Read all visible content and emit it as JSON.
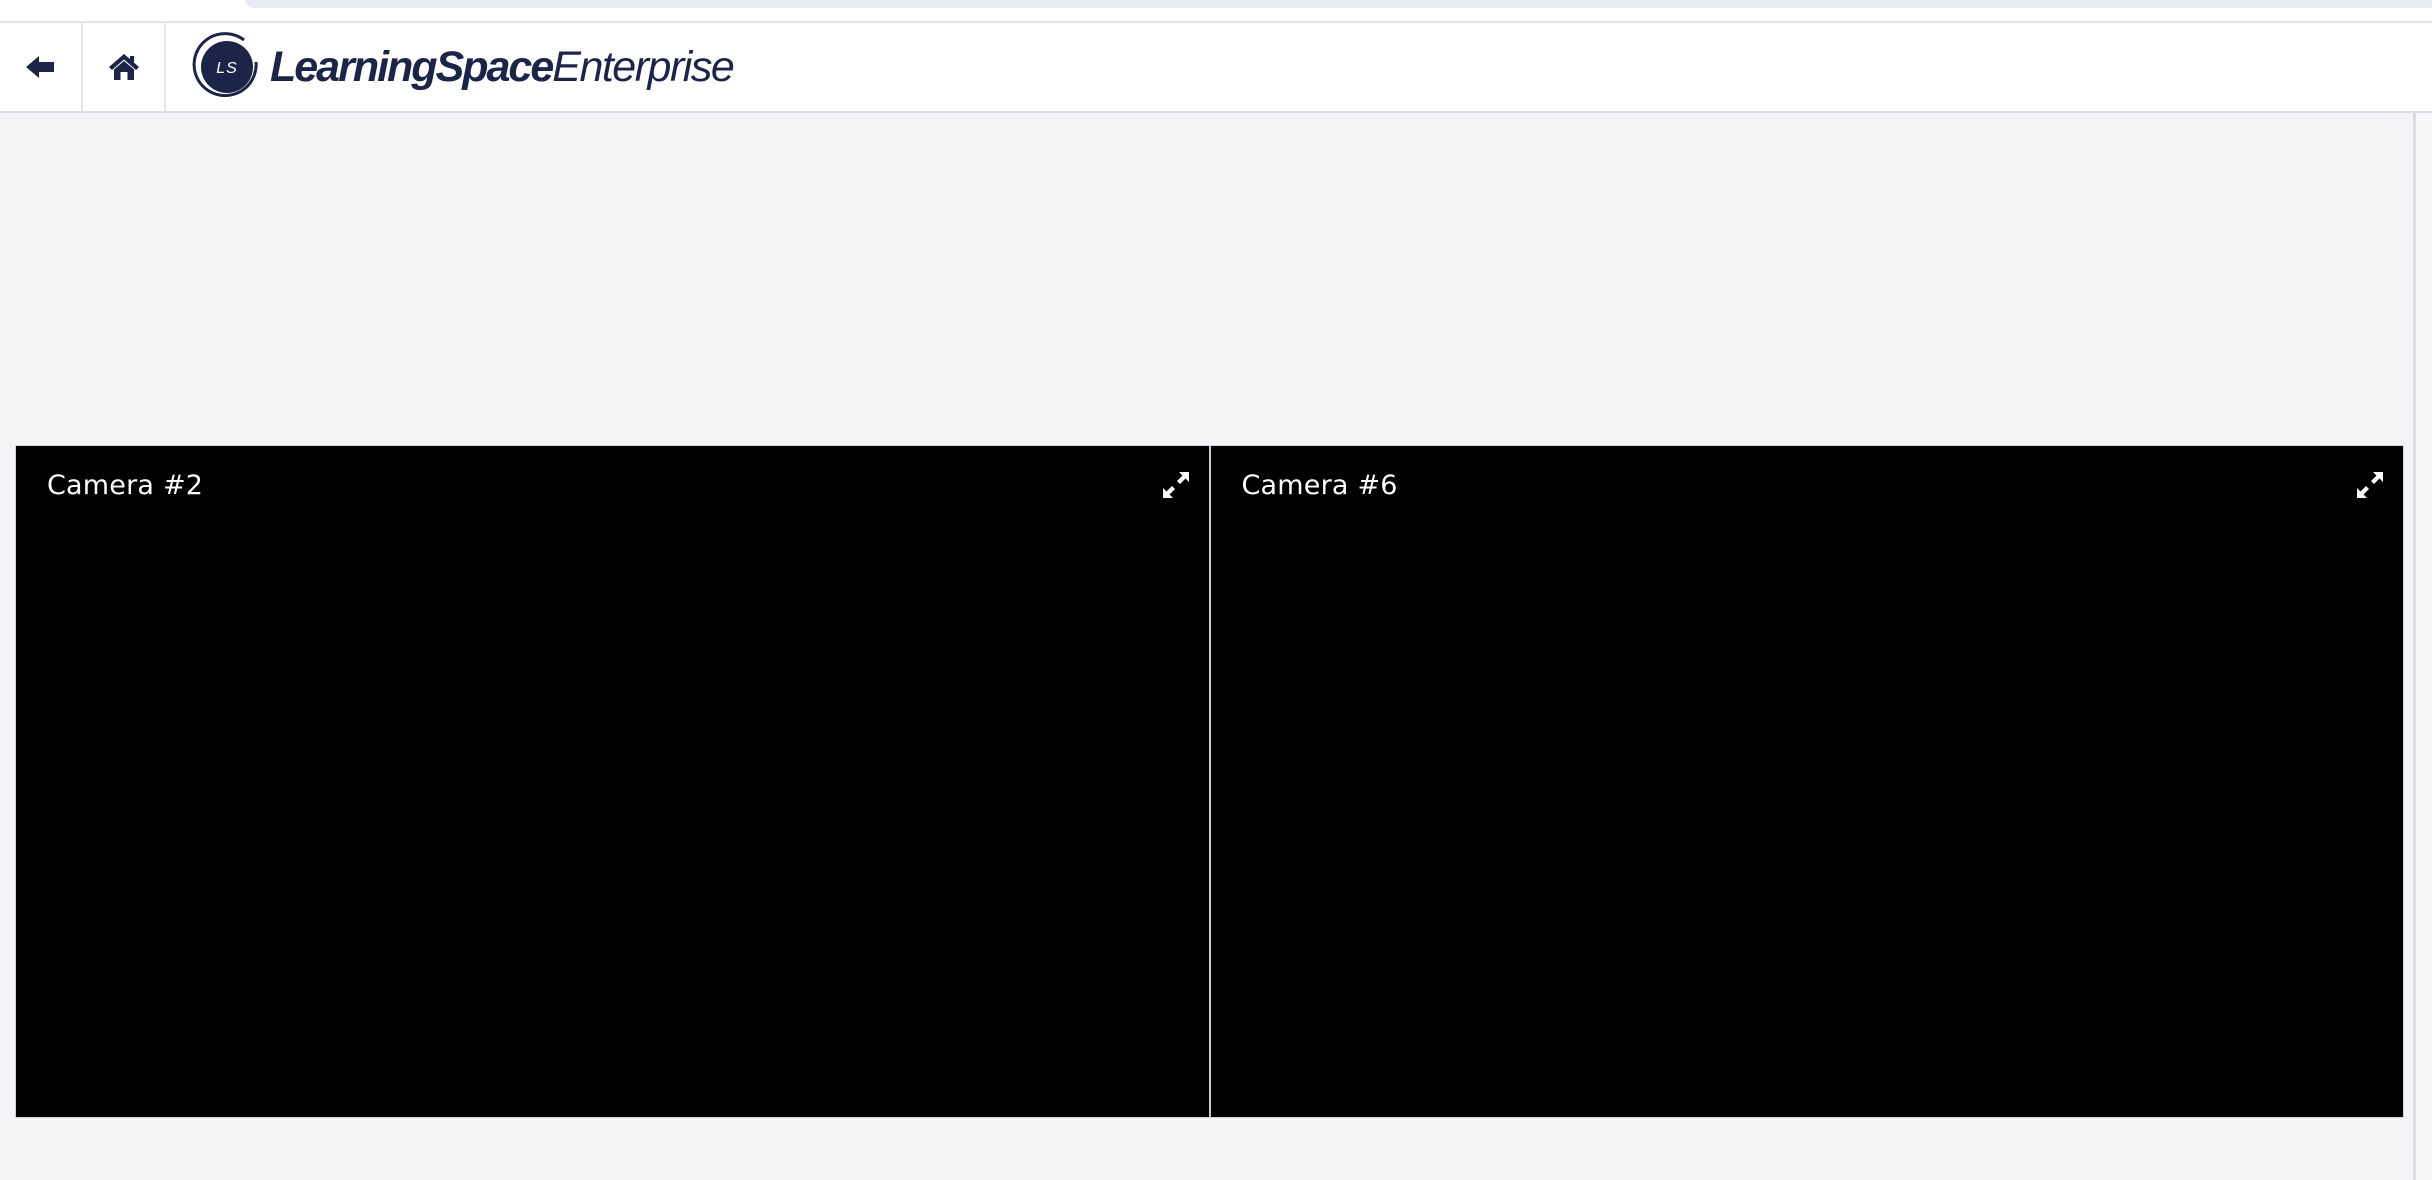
{
  "header": {
    "back_icon": "arrow-left-icon",
    "home_icon": "home-icon",
    "logo_monogram": "LS",
    "brand_bold": "LearningSpace",
    "brand_light": "Enterprise",
    "brand_color": "#1c2447"
  },
  "cameras": [
    {
      "label": "Camera #2",
      "icon": "expand-icon"
    },
    {
      "label": "Camera #6",
      "icon": "expand-icon"
    }
  ],
  "colors": {
    "background": "#f3f4f6",
    "video_background": "#000000",
    "accent": "#1c2447"
  }
}
